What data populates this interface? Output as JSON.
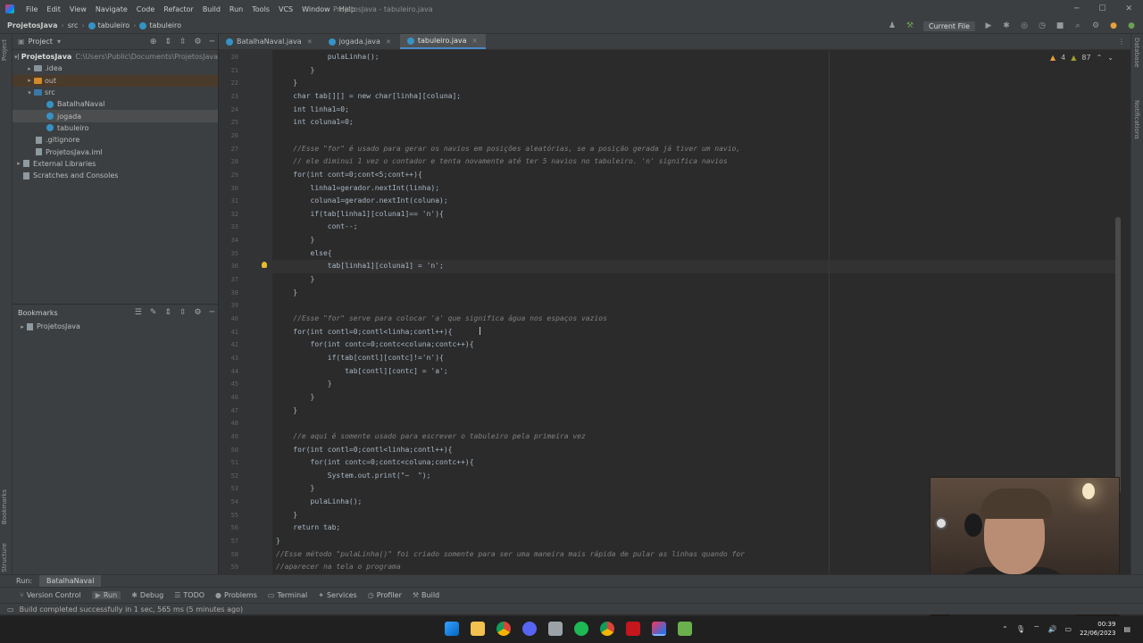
{
  "window": {
    "title": "ProjetosJava - tabuleiro.java",
    "menu": [
      "File",
      "Edit",
      "View",
      "Navigate",
      "Code",
      "Refactor",
      "Build",
      "Run",
      "Tools",
      "VCS",
      "Window",
      "Help"
    ]
  },
  "breadcrumb": [
    "ProjetosJava",
    "src",
    "tabuleiro",
    "tabuleiro"
  ],
  "toolbar": {
    "run_config": "Current File"
  },
  "project_panel": {
    "title": "Project",
    "tree": [
      {
        "label": "ProjetosJava",
        "path": "C:\\Users\\Public\\Documents\\ProjetosJava",
        "icon": "folder-icon"
      },
      {
        "label": ".idea",
        "icon": "folder-icon"
      },
      {
        "label": "out",
        "icon": "folder-orange-icon"
      },
      {
        "label": "src",
        "icon": "folder-blue-icon"
      },
      {
        "label": "BatalhaNaval",
        "icon": "java-class-icon"
      },
      {
        "label": "jogada",
        "icon": "java-class-icon"
      },
      {
        "label": "tabuleiro",
        "icon": "java-class-icon"
      },
      {
        "label": ".gitignore",
        "icon": "file-icon"
      },
      {
        "label": "ProjetosJava.iml",
        "icon": "file-icon"
      },
      {
        "label": "External Libraries",
        "icon": "library-icon"
      },
      {
        "label": "Scratches and Consoles",
        "icon": "scratches-icon"
      }
    ]
  },
  "bookmarks_panel": {
    "title": "Bookmarks",
    "items": [
      "ProjetosJava"
    ]
  },
  "editor": {
    "tabs": [
      {
        "label": "BatalhaNaval.java"
      },
      {
        "label": "jogada.java"
      },
      {
        "label": "tabuleiro.java",
        "active": true
      }
    ],
    "warnings": "4",
    "weak_warnings": "87",
    "current_line": "36",
    "lines": [
      {
        "n": "20",
        "t": "            pulaLinha();"
      },
      {
        "n": "21",
        "t": "        }"
      },
      {
        "n": "22",
        "t": "    }"
      },
      {
        "n": "23",
        "t": "    char tab[][] = new char[linha][coluna];"
      },
      {
        "n": "24",
        "t": "    int linha1=0;"
      },
      {
        "n": "25",
        "t": "    int coluna1=0;"
      },
      {
        "n": "26",
        "t": ""
      },
      {
        "n": "27",
        "t": "    //Esse \"for\" é usado para gerar os navios em posições aleatórias, se a posição gerada já tiver um navio,"
      },
      {
        "n": "28",
        "t": "    // ele diminui 1 vez o contador e tenta novamente até ter 5 navios no tabuleiro. 'n' significa navios"
      },
      {
        "n": "29",
        "t": "    for(int cont=0;cont<5;cont++){"
      },
      {
        "n": "30",
        "t": "        linha1=gerador.nextInt(linha);"
      },
      {
        "n": "31",
        "t": "        coluna1=gerador.nextInt(coluna);"
      },
      {
        "n": "32",
        "t": "        if(tab[linha1][coluna1]== 'n'){"
      },
      {
        "n": "33",
        "t": "            cont--;"
      },
      {
        "n": "34",
        "t": "        }"
      },
      {
        "n": "35",
        "t": "        else{"
      },
      {
        "n": "36",
        "t": "            tab[linha1][coluna1] = 'n';"
      },
      {
        "n": "37",
        "t": "        }"
      },
      {
        "n": "38",
        "t": "    }"
      },
      {
        "n": "39",
        "t": ""
      },
      {
        "n": "40",
        "t": "    //Esse \"for\" serve para colocar 'a' que significa água nos espaços vazios"
      },
      {
        "n": "41",
        "t": "    for(int contl=0;contl<linha;contl++){"
      },
      {
        "n": "42",
        "t": "        for(int contc=0;contc<coluna;contc++){"
      },
      {
        "n": "43",
        "t": "            if(tab[contl][contc]!='n'){"
      },
      {
        "n": "44",
        "t": "                tab[contl][contc] = 'a';"
      },
      {
        "n": "45",
        "t": "            }"
      },
      {
        "n": "46",
        "t": "        }"
      },
      {
        "n": "47",
        "t": "    }"
      },
      {
        "n": "48",
        "t": ""
      },
      {
        "n": "49",
        "t": "    //e aqui é somente usado para escrever o tabuleiro pela primeira vez"
      },
      {
        "n": "50",
        "t": "    for(int contl=0;contl<linha;contl++){"
      },
      {
        "n": "51",
        "t": "        for(int contc=0;contc<coluna;contc++){"
      },
      {
        "n": "52",
        "t": "            System.out.print(\"~  \");"
      },
      {
        "n": "53",
        "t": "        }"
      },
      {
        "n": "54",
        "t": "        pulaLinha();"
      },
      {
        "n": "55",
        "t": "    }"
      },
      {
        "n": "56",
        "t": "    return tab;"
      },
      {
        "n": "57",
        "t": "}"
      },
      {
        "n": "58",
        "t": "//Esse método \"pulaLinha()\" foi criado somente para ser uma maneira mais rápida de pular as linhas quando for"
      },
      {
        "n": "59",
        "t": "//aparecer na tela o programa"
      }
    ]
  },
  "run_bar": {
    "label": "Run:",
    "tab": "BatalhaNaval"
  },
  "tool_windows": [
    "Version Control",
    "Run",
    "Debug",
    "TODO",
    "Problems",
    "Terminal",
    "Services",
    "Profiler",
    "Build"
  ],
  "status": {
    "message": "Build completed successfully in 1 sec, 565 ms (5 minutes ago)"
  },
  "side_labels": {
    "left_top": "Project",
    "left_bottom": "Bookmarks",
    "left_bottom2": "Structure",
    "right_top": "Database",
    "right_mid": "Notifications"
  },
  "taskbar": {
    "time": "00:39",
    "date": "22/06/2023",
    "apps": [
      "windows-start",
      "file-explorer",
      "chrome",
      "discord",
      "app-generic",
      "spotify",
      "chrome-alt",
      "acrobat",
      "intellij",
      "other-app"
    ]
  },
  "colors": {
    "keyword": "#cc7832",
    "comment": "#808080",
    "string": "#6a8759",
    "method": "#ffc66d",
    "text": "#a9b7c6",
    "accent": "#4a88c7"
  }
}
